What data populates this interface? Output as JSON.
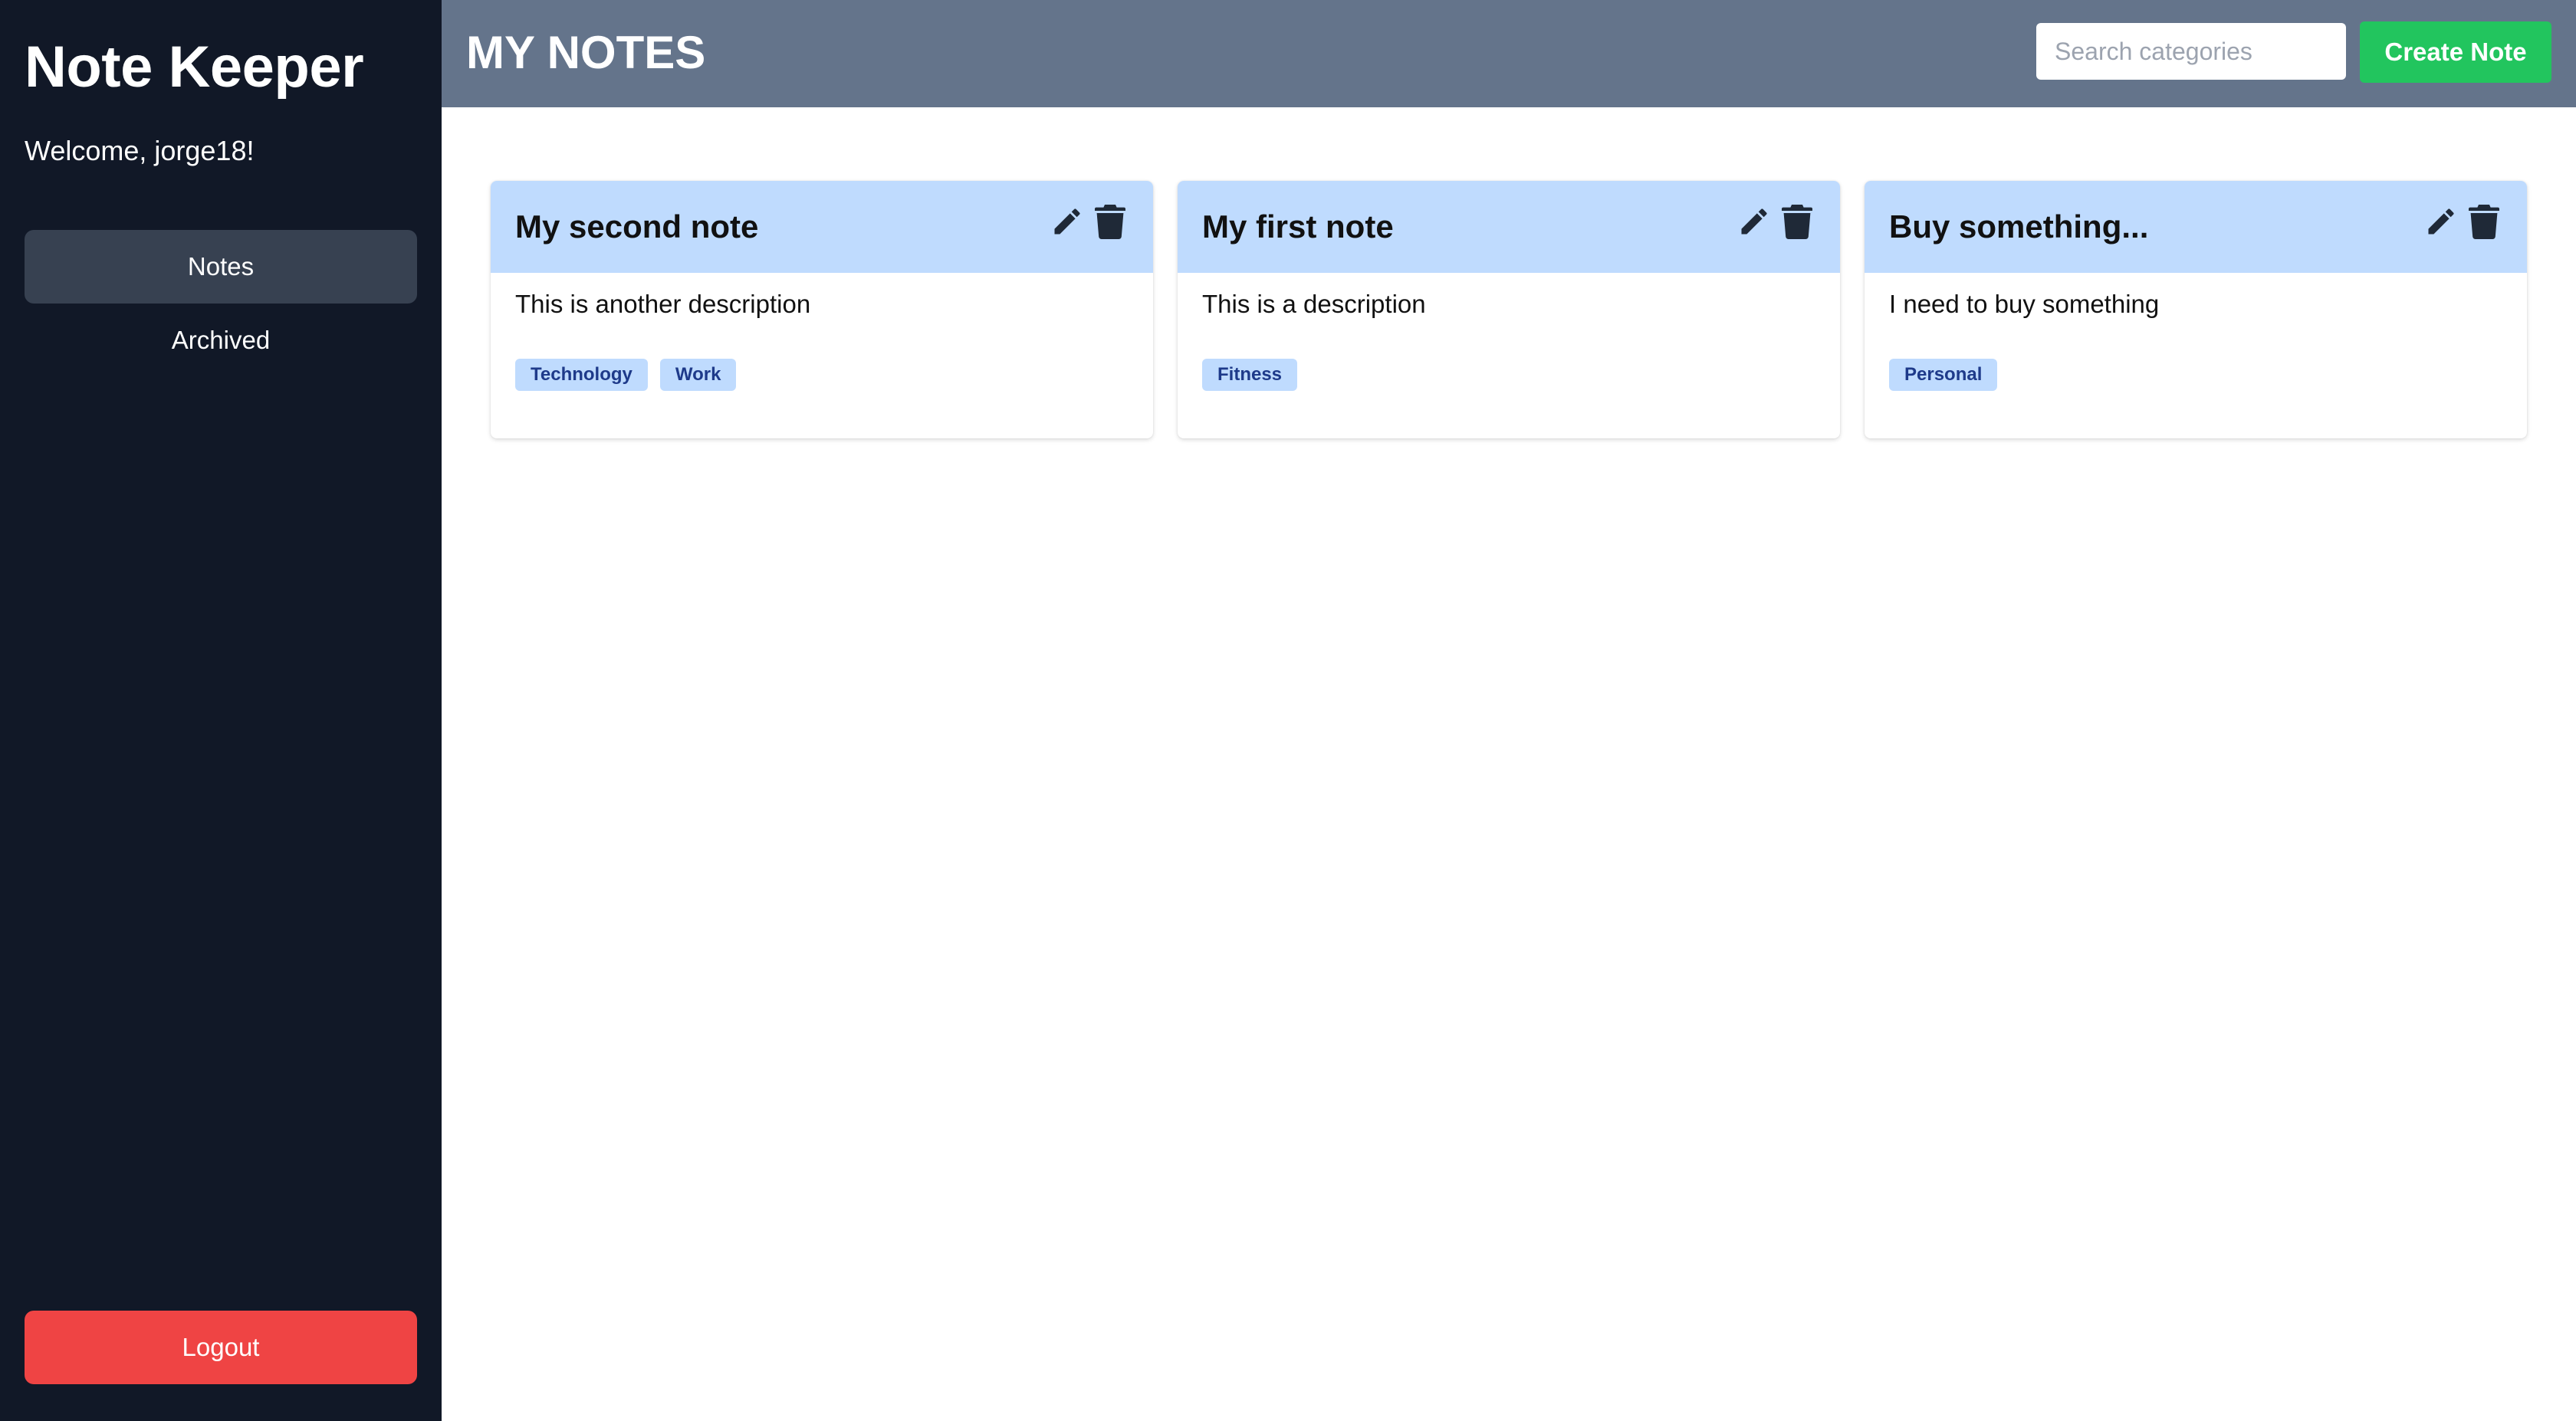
{
  "app": {
    "title": "Note Keeper",
    "welcome": "Welcome, jorge18!"
  },
  "sidebar": {
    "items": [
      {
        "label": "Notes",
        "active": true
      },
      {
        "label": "Archived",
        "active": false
      }
    ],
    "logout_label": "Logout"
  },
  "header": {
    "title": "MY NOTES",
    "search_placeholder": "Search categories",
    "search_value": "",
    "create_label": "Create Note"
  },
  "notes": [
    {
      "title": "My second note",
      "description": "This is another description",
      "tags": [
        "Technology",
        "Work"
      ],
      "icons": [
        "pencil-icon",
        "trash-icon"
      ]
    },
    {
      "title": "My first note",
      "description": "This is a description",
      "tags": [
        "Fitness"
      ],
      "icons": [
        "pencil-icon",
        "trash-icon"
      ]
    },
    {
      "title": "Buy something...",
      "description": "I need to buy something",
      "tags": [
        "Personal"
      ],
      "icons": [
        "pencil-icon",
        "trash-icon"
      ]
    }
  ],
  "colors": {
    "sidebar_bg": "#111827",
    "active_nav_bg": "#374151",
    "header_bg": "#64748b",
    "create_button": "#22c55e",
    "logout_button": "#ef4444",
    "card_header": "#bfdbfe",
    "tag_bg": "#bfdbfe",
    "tag_text": "#1e3a8a"
  }
}
